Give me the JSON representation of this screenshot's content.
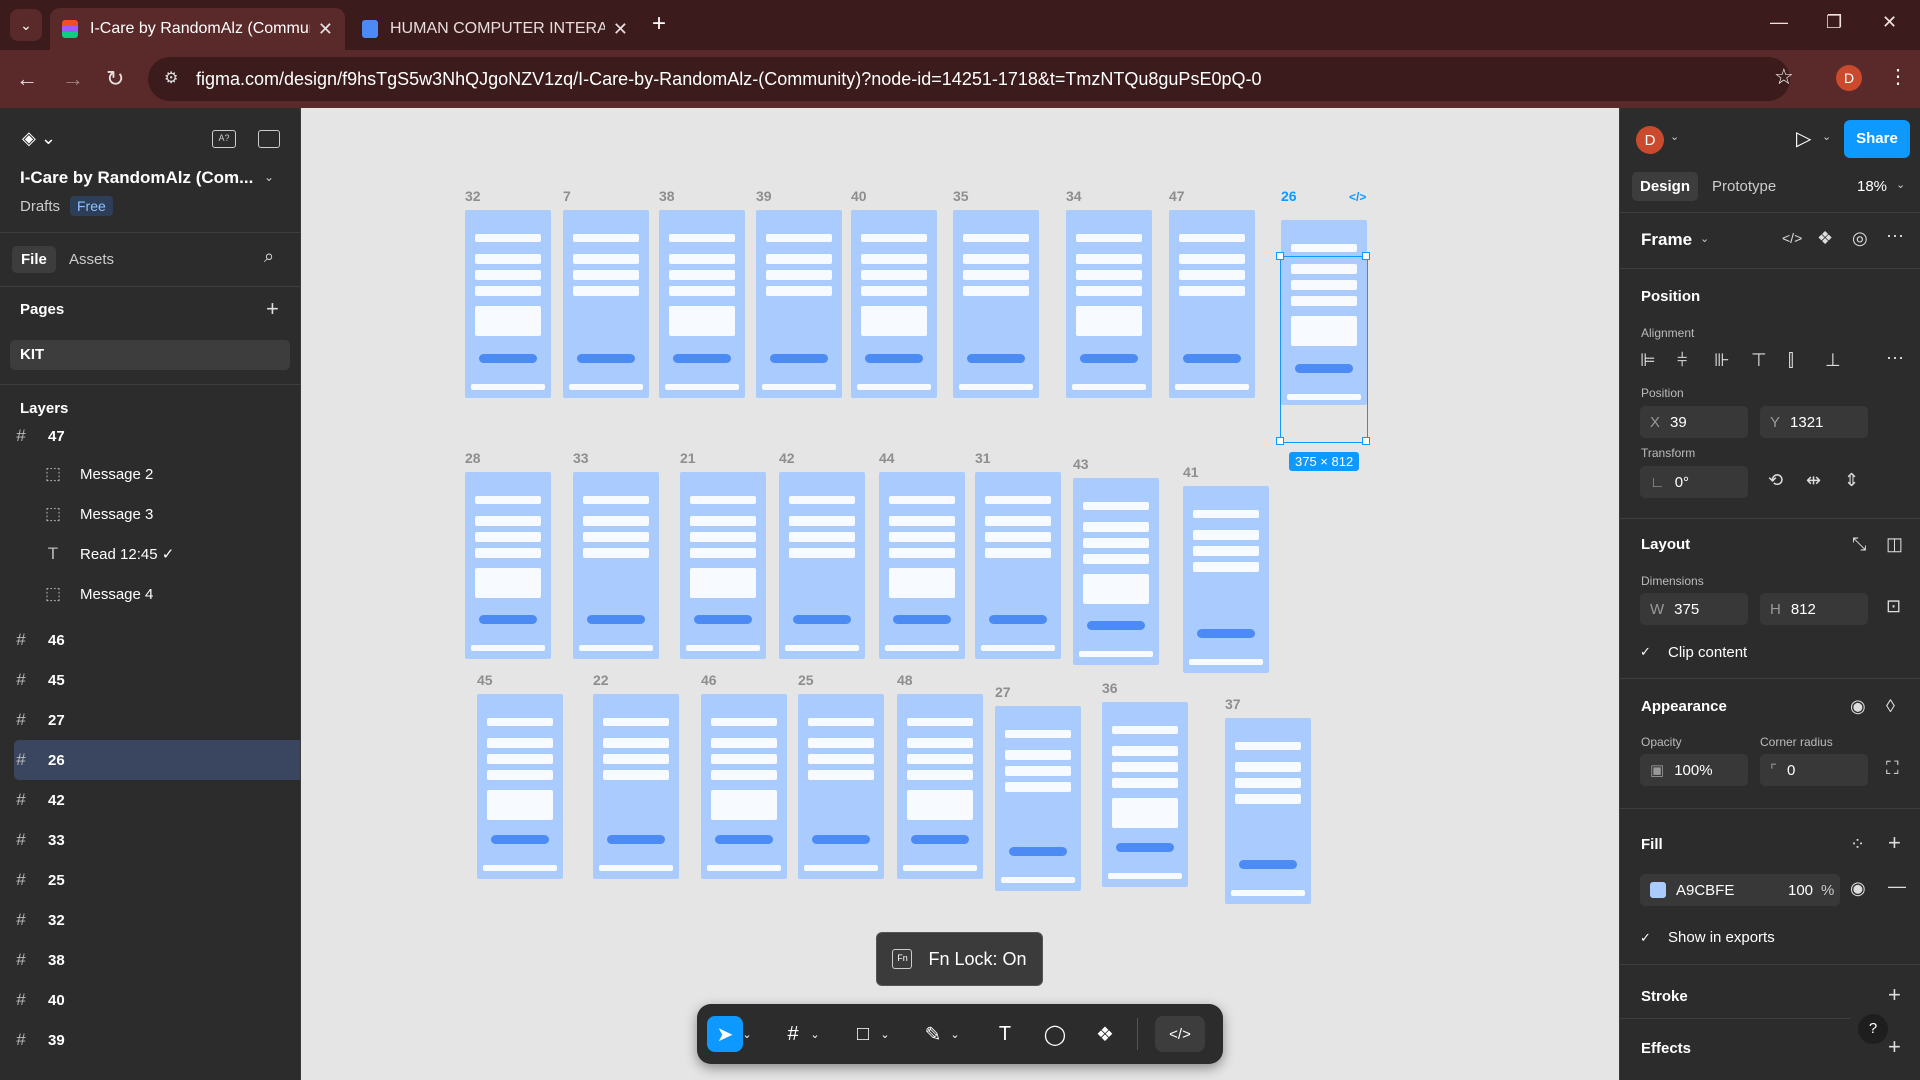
{
  "browser": {
    "tabs": [
      {
        "label": "I-Care by RandomAlz (Community)",
        "active": true
      },
      {
        "label": "HUMAN COMPUTER INTERACTION",
        "active": false
      }
    ],
    "url": "figma.com/design/f9hsTgS5w3NhQJgoNZV1zq/I-Care-by-RandomAlz-(Community)?node-id=14251-1718&t=TmzNTQu8guPsE0pQ-0",
    "profile_initial": "D"
  },
  "left_panel": {
    "file_title": "I-Care by RandomAlz (Com...",
    "drafts": "Drafts",
    "plan_badge": "Free",
    "tabs": [
      "File",
      "Assets"
    ],
    "pages_label": "Pages",
    "pages": [
      "KIT"
    ],
    "layers_label": "Layers",
    "layers": [
      {
        "icon": "#",
        "label": "47",
        "indent": 0,
        "selected": false
      },
      {
        "icon": "frame",
        "label": "Message 2",
        "indent": 1,
        "selected": false
      },
      {
        "icon": "frame",
        "label": "Message 3",
        "indent": 1,
        "selected": false
      },
      {
        "icon": "T",
        "label": "Read 12:45 ✓",
        "indent": 1,
        "selected": false
      },
      {
        "icon": "frame",
        "label": "Message 4",
        "indent": 1,
        "selected": false
      },
      {
        "icon": "#",
        "label": "46",
        "indent": 0,
        "selected": false
      },
      {
        "icon": "#",
        "label": "45",
        "indent": 0,
        "selected": false
      },
      {
        "icon": "#",
        "label": "27",
        "indent": 0,
        "selected": false
      },
      {
        "icon": "#",
        "label": "26",
        "indent": 0,
        "selected": true
      },
      {
        "icon": "#",
        "label": "42",
        "indent": 0,
        "selected": false
      },
      {
        "icon": "#",
        "label": "33",
        "indent": 0,
        "selected": false
      },
      {
        "icon": "#",
        "label": "25",
        "indent": 0,
        "selected": false
      },
      {
        "icon": "#",
        "label": "32",
        "indent": 0,
        "selected": false
      },
      {
        "icon": "#",
        "label": "38",
        "indent": 0,
        "selected": false
      },
      {
        "icon": "#",
        "label": "40",
        "indent": 0,
        "selected": false
      },
      {
        "icon": "#",
        "label": "39",
        "indent": 0,
        "selected": false
      }
    ]
  },
  "canvas": {
    "frames_row1": [
      "32",
      "7",
      "38",
      "39",
      "40",
      "35",
      "34",
      "47",
      "26"
    ],
    "frames_row2": [
      "28",
      "33",
      "21",
      "42",
      "44",
      "31",
      "43",
      "41"
    ],
    "frames_row3": [
      "45",
      "22",
      "46",
      "25",
      "48",
      "27",
      "36",
      "37"
    ],
    "selection_size": "375 × 812",
    "toast": "Fn Lock: On"
  },
  "right_panel": {
    "user_initial": "D",
    "share_label": "Share",
    "tabs": [
      "Design",
      "Prototype"
    ],
    "zoom": "18%",
    "frame_label": "Frame",
    "position_title": "Position",
    "alignment_label": "Alignment",
    "position_label": "Position",
    "x_label": "X",
    "x_value": "39",
    "y_label": "Y",
    "y_value": "1321",
    "transform_label": "Transform",
    "rotation": "0°",
    "layout_title": "Layout",
    "dimensions_label": "Dimensions",
    "w_label": "W",
    "w_value": "375",
    "h_label": "H",
    "h_value": "812",
    "clip_content": "Clip content",
    "appearance_title": "Appearance",
    "opacity_label": "Opacity",
    "opacity_value": "100%",
    "radius_label": "Corner radius",
    "radius_value": "0",
    "fill_title": "Fill",
    "fill_hex": "A9CBFE",
    "fill_opacity": "100",
    "fill_pct": "%",
    "show_in_exports": "Show in exports",
    "stroke_title": "Stroke",
    "effects_title": "Effects",
    "help": "?"
  },
  "colors": {
    "frame_fill": "#a9cbfe",
    "accent": "#0d99ff",
    "selection": "#3a4660"
  }
}
